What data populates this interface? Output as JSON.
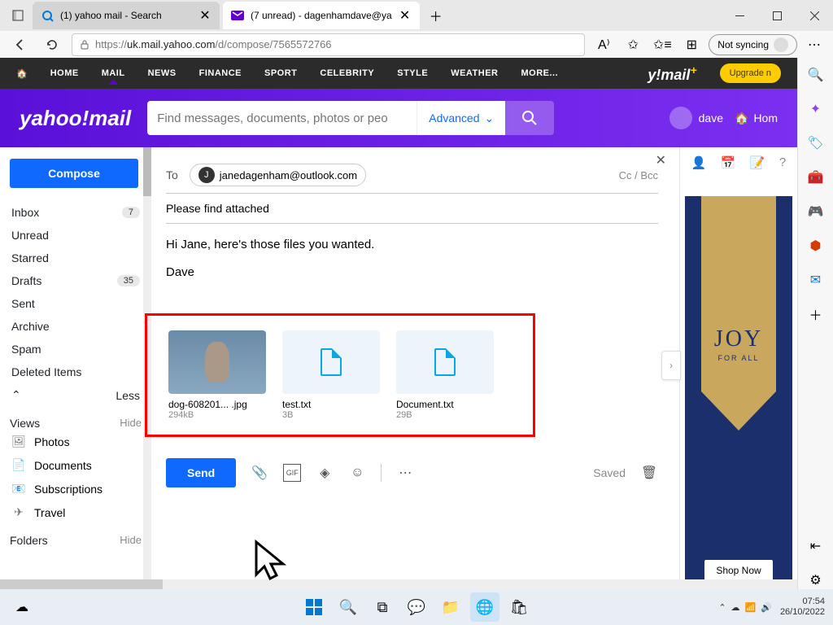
{
  "browser": {
    "tabs": [
      {
        "title": "(1) yahoo mail - Search",
        "active": false
      },
      {
        "title": "(7 unread) - dagenhamdave@ya",
        "active": true
      }
    ],
    "url_prefix": "https://",
    "url_host": "uk.mail.yahoo.com",
    "url_path": "/d/compose/7565572766",
    "sync_label": "Not syncing"
  },
  "ynav": {
    "items": [
      "HOME",
      "MAIL",
      "NEWS",
      "FINANCE",
      "SPORT",
      "CELEBRITY",
      "STYLE",
      "WEATHER",
      "MORE..."
    ],
    "logo": "y!mail",
    "upgrade": "Upgrade n"
  },
  "yheader": {
    "logo": "yahoo!mail",
    "search_placeholder": "Find messages, documents, photos or peo",
    "advanced": "Advanced",
    "user": "dave",
    "home": "Hom"
  },
  "sidebar": {
    "compose": "Compose",
    "folders": [
      {
        "name": "Inbox",
        "badge": "7"
      },
      {
        "name": "Unread",
        "badge": ""
      },
      {
        "name": "Starred",
        "badge": ""
      },
      {
        "name": "Drafts",
        "badge": "35"
      },
      {
        "name": "Sent",
        "badge": ""
      },
      {
        "name": "Archive",
        "badge": ""
      },
      {
        "name": "Spam",
        "badge": ""
      },
      {
        "name": "Deleted Items",
        "badge": ""
      }
    ],
    "less": "Less",
    "views_header": "Views",
    "hide": "Hide",
    "views": [
      {
        "icon": "🖼",
        "label": "Photos"
      },
      {
        "icon": "📄",
        "label": "Documents"
      },
      {
        "icon": "📧",
        "label": "Subscriptions"
      },
      {
        "icon": "✈",
        "label": "Travel"
      }
    ],
    "folders_header": "Folders"
  },
  "compose": {
    "to_label": "To",
    "recipient": "janedagenham@outlook.com",
    "recipient_initial": "J",
    "ccbcc": "Cc / Bcc",
    "subject": "Please find attached",
    "body_line1": "Hi Jane, here's those files you wanted.",
    "body_line2": "Dave",
    "attachments": [
      {
        "name": "dog-608201... .jpg",
        "size": "294kB",
        "type": "image"
      },
      {
        "name": "test.txt",
        "size": "3B",
        "type": "file"
      },
      {
        "name": "Document.txt",
        "size": "29B",
        "type": "file"
      }
    ],
    "send": "Send",
    "saved": "Saved"
  },
  "ad": {
    "joy": "JOY",
    "sub": "FOR ALL",
    "cta": "Shop Now"
  },
  "taskbar": {
    "time": "07:54",
    "date": "26/10/2022"
  }
}
